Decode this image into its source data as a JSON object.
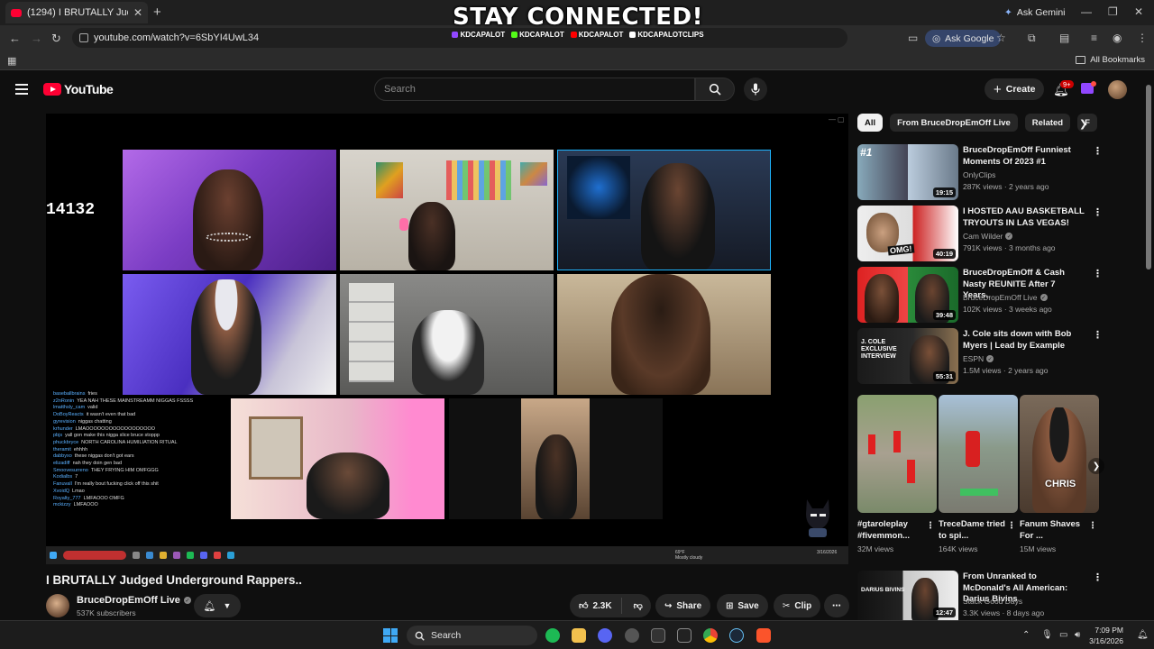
{
  "browser": {
    "tab_title": "(1294) I BRUTALLY Judged U",
    "url": "youtube.com/watch?v=6SbYI4UwL34",
    "ask_gemini": "Ask Gemini",
    "ask_google": "Ask Google",
    "all_bookmarks": "All Bookmarks"
  },
  "stream_overlay": {
    "title": "STAY CONNECTED!",
    "handles": [
      {
        "name": "KDCAPALOT",
        "platform": "twitch",
        "color": "#9147ff"
      },
      {
        "name": "KDCAPALOT",
        "platform": "kick",
        "color": "#53fc18"
      },
      {
        "name": "KDCAPALOT",
        "platform": "youtube",
        "color": "#ff0000"
      },
      {
        "name": "KDCAPALOTCLIPS",
        "platform": "tiktok",
        "color": "#ffffff"
      }
    ]
  },
  "youtube": {
    "logo_text": "YouTube",
    "search_placeholder": "Search",
    "create_label": "Create",
    "notification_badge": "9+"
  },
  "player": {
    "counter": "14132",
    "chat": [
      {
        "user": "baseballbrains",
        "msg": "fries"
      },
      {
        "user": "z2nRonin",
        "msg": "YEA NAH THESE MAINSTREAMM NIGGAS FSSSS"
      },
      {
        "user": "lmatthsly_cam",
        "msg": "valid"
      },
      {
        "user": "DoBoyReacts",
        "msg": "it wasn't even that bad"
      },
      {
        "user": "gyrevision",
        "msg": "niggas chatting"
      },
      {
        "user": "krhunder",
        "msg": "LMAOOOOOOOOOOOOOOOOOO"
      },
      {
        "user": "pbjs",
        "msg": "yall gon make this nigga slice bruce stoppp"
      },
      {
        "user": "phuckbryce",
        "msg": "NORTH CAROLINA HUMILIATION RITUAL"
      },
      {
        "user": "theramit",
        "msg": "ehhhh"
      },
      {
        "user": "dabbyxo",
        "msg": "these niggas don't got ears"
      },
      {
        "user": "elizadiff",
        "msg": "nah they doin gen bad"
      },
      {
        "user": "Smoovesurreno",
        "msg": "THEY FRYING HIM OMFGGG"
      },
      {
        "user": "Kodialbs",
        "msg": "7"
      },
      {
        "user": "Fanuvall",
        "msg": "I'm really bout fucking click off this shit"
      },
      {
        "user": "XvoidQ",
        "msg": "Lmao"
      },
      {
        "user": "Royalty_777",
        "msg": "LMFAOOO OMFG"
      },
      {
        "user": "mckizzy",
        "msg": "LMFAOOO"
      }
    ],
    "weather_temp": "69°F",
    "weather_desc": "Mostly cloudy",
    "video_clock": "3/16/2026"
  },
  "video": {
    "title": "I BRUTALLY Judged Underground Rappers..",
    "channel": "BruceDropEmOff Live",
    "subscribers": "537K subscribers",
    "likes": "2.3K",
    "share": "Share",
    "save": "Save",
    "clip": "Clip"
  },
  "sidebar": {
    "chips": [
      "All",
      "From BruceDropEmOff Live",
      "Related",
      "F"
    ],
    "recommendations": [
      {
        "title": "BruceDropEmOff Funniest Moments Of 2023 #1",
        "channel": "OnlyClips",
        "views": "287K views",
        "age": "2 years ago",
        "duration": "19:15",
        "verified": false
      },
      {
        "title": "I HOSTED AAU BASKETBALL TRYOUTS IN LAS VEGAS!",
        "channel": "Cam Wilder",
        "views": "791K views",
        "age": "3 months ago",
        "duration": "40:19",
        "verified": true
      },
      {
        "title": "BruceDropEmOff & Cash Nasty REUNITE After 7 Years..",
        "channel": "BruceDropEmOff Live",
        "views": "102K views",
        "age": "3 weeks ago",
        "duration": "39:48",
        "verified": true
      },
      {
        "title": "J. Cole sits down with Bob Myers | Lead by Example",
        "channel": "ESPN",
        "views": "1.5M views",
        "age": "2 years ago",
        "duration": "55:31",
        "verified": true
      },
      {
        "title": "From Unranked to McDonald's All American: Darius Bivins",
        "channel": "Stack Good Days",
        "views": "3.3K views",
        "age": "8 days ago",
        "duration": "12:47",
        "verified": false
      }
    ],
    "thumb_texts": [
      "OMG!",
      "J. COLE EXCLUSIVE INTERVIEW",
      "DARIUS BIVINS"
    ],
    "shorts": [
      {
        "title": "#gtaroleplay #fivemmon...",
        "views": "32M views"
      },
      {
        "title": "TreceDame tried to spi...",
        "views": "164K views"
      },
      {
        "title": "Fanum Shaves For ...",
        "views": "15M views"
      }
    ],
    "short_overlay": "CHRIS"
  },
  "taskbar": {
    "search_label": "Search",
    "time": "7:09 PM",
    "date": "3/16/2026"
  }
}
